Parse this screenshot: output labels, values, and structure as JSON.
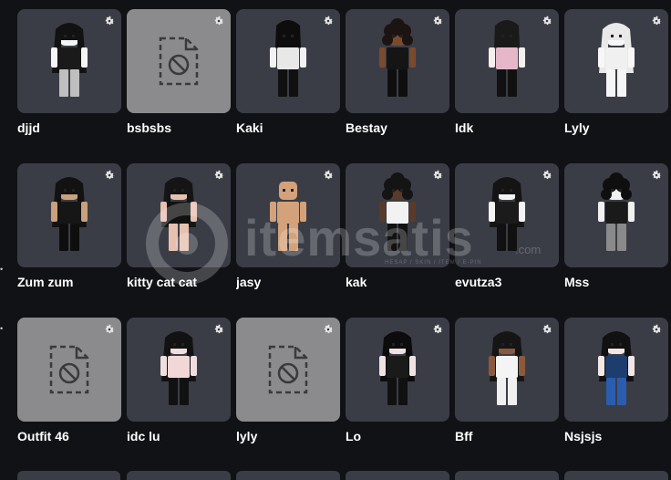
{
  "outfits": [
    {
      "label": "djjd",
      "kind": "avatar",
      "skin": "#f5f5f5",
      "hair": "#121212",
      "top": "#1a1a1a",
      "bottom": "#bfbfbf",
      "hairStyle": "long"
    },
    {
      "label": "bsbsbs",
      "kind": "placeholder"
    },
    {
      "label": "Kaki",
      "kind": "avatar",
      "skin": "#f2f2f2",
      "hair": "#0d0d0d",
      "top": "#e8e8e8",
      "bottom": "#101010",
      "hairStyle": "hood"
    },
    {
      "label": "Bestay",
      "kind": "avatar",
      "skin": "#7a4a2e",
      "hair": "#1c1412",
      "top": "#151515",
      "bottom": "#0f0f0f",
      "hairStyle": "curly"
    },
    {
      "label": "Idk",
      "kind": "avatar",
      "skin": "#f5f0ee",
      "hair": "#1a1a1a",
      "top": "#e6b7c8",
      "bottom": "#111111",
      "hairStyle": "hood"
    },
    {
      "label": "Lyly",
      "kind": "avatar",
      "skin": "#f7f7f7",
      "hair": "#e9e9e9",
      "top": "#f0f0f0",
      "bottom": "#f5f5f5",
      "hairStyle": "long"
    },
    {
      "label": "Zum zum",
      "kind": "avatar",
      "skin": "#c9a17a",
      "hair": "#121212",
      "top": "#161616",
      "bottom": "#0e0e0e",
      "hairStyle": "long"
    },
    {
      "label": "kitty cat cat",
      "kind": "avatar",
      "skin": "#e7c1b0",
      "hair": "#151515",
      "top": "#111111",
      "bottom": "#e7c1b0",
      "hairStyle": "long"
    },
    {
      "label": "jasy",
      "kind": "avatar",
      "skin": "#d3a27a",
      "hair": "#d3a27a",
      "top": "#d3a27a",
      "bottom": "#d3a27a",
      "hairStyle": "bald"
    },
    {
      "label": "kak",
      "kind": "avatar",
      "skin": "#5a3a28",
      "hair": "#141414",
      "top": "#f2f2f2",
      "bottom": "#121212",
      "hairStyle": "curly"
    },
    {
      "label": "evutza3",
      "kind": "avatar",
      "skin": "#f3f3f3",
      "hair": "#141414",
      "top": "#1b1b1b",
      "bottom": "#111111",
      "hairStyle": "long"
    },
    {
      "label": "Mss",
      "kind": "avatar",
      "skin": "#f1f1f1",
      "hair": "#0f0f0f",
      "top": "#1a1a1a",
      "bottom": "#8a8a8a",
      "hairStyle": "curly"
    },
    {
      "label": "Outfit 46",
      "kind": "placeholder"
    },
    {
      "label": "idc lu",
      "kind": "avatar",
      "skin": "#f0dede",
      "hair": "#121212",
      "top": "#f2d7d7",
      "bottom": "#111111",
      "hairStyle": "long"
    },
    {
      "label": "lyly",
      "kind": "placeholder"
    },
    {
      "label": "Lo",
      "kind": "avatar",
      "skin": "#efe2e2",
      "hair": "#0c0c0c",
      "top": "#1a1a1a",
      "bottom": "#111111",
      "hairStyle": "long"
    },
    {
      "label": "Bff",
      "kind": "avatar",
      "skin": "#8b5a3c",
      "hair": "#151515",
      "top": "#f4f4f4",
      "bottom": "#f0f0f0",
      "hairStyle": "long"
    },
    {
      "label": "Nsjsjs",
      "kind": "avatar",
      "skin": "#f3e6e6",
      "hair": "#111111",
      "top": "#1d3d6e",
      "bottom": "#2a5db0",
      "hairStyle": "long"
    }
  ],
  "watermark": {
    "text": "itemsatis",
    "sub": "HESAP / SKIN / ITEM / E-PIN",
    "suffix": ".com"
  },
  "colors": {
    "tile": "#3b3d46",
    "placeholder": "#8b8b8d",
    "background": "#111216"
  }
}
